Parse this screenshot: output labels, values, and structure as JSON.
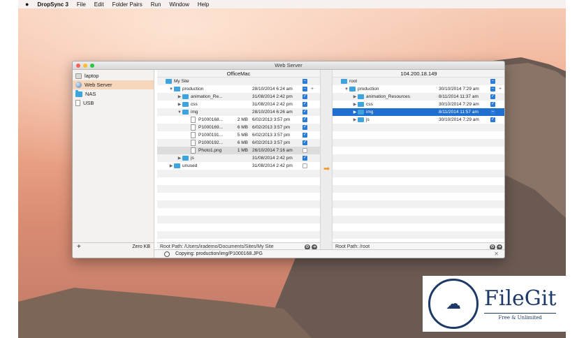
{
  "menubar": {
    "app": "DropSync 3",
    "items": [
      "File",
      "Edit",
      "Folder Pairs",
      "Run",
      "Window",
      "Help"
    ]
  },
  "window": {
    "title": "Web Server"
  },
  "sidebar": {
    "items": [
      {
        "label": "laptop",
        "icon": "display-icon"
      },
      {
        "label": "Web Server",
        "icon": "globe-icon",
        "selected": true
      },
      {
        "label": "NAS",
        "icon": "folder-icon"
      },
      {
        "label": "USB",
        "icon": "drive-icon"
      }
    ],
    "add": "+",
    "size": "Zero KB"
  },
  "left": {
    "header": "OfficeMac",
    "root_path": "Root Path: /Users/irademo/Documents/Sites/My Site",
    "rows": [
      {
        "name": "My Site",
        "indent": 0,
        "tri": "",
        "type": "folder",
        "size": "",
        "date": "",
        "check": "minus"
      },
      {
        "name": "production",
        "indent": 1,
        "tri": "▼",
        "type": "folder",
        "size": "",
        "date": "28/10/2014 6:24 am",
        "check": "minus",
        "plus": true
      },
      {
        "name": "animation_Re...",
        "indent": 2,
        "tri": "▶",
        "type": "folder",
        "size": "",
        "date": "31/08/2014 2:42 pm",
        "check": "on"
      },
      {
        "name": "css",
        "indent": 2,
        "tri": "▶",
        "type": "folder",
        "size": "",
        "date": "31/08/2014 2:42 pm",
        "check": "on"
      },
      {
        "name": "img",
        "indent": 2,
        "tri": "▼",
        "type": "folder",
        "size": "",
        "date": "28/10/2014 6:26 am",
        "check": "on"
      },
      {
        "name": "P1000168...",
        "indent": 3,
        "tri": "",
        "type": "file",
        "size": "2 MB",
        "date": "6/02/2013 3:57 pm",
        "check": "on"
      },
      {
        "name": "P1000169...",
        "indent": 3,
        "tri": "",
        "type": "file",
        "size": "6 MB",
        "date": "6/02/2013 3:57 pm",
        "check": "on"
      },
      {
        "name": "P1000191...",
        "indent": 3,
        "tri": "",
        "type": "file",
        "size": "5 MB",
        "date": "6/02/2013 3:57 pm",
        "check": "on"
      },
      {
        "name": "P1000192...",
        "indent": 3,
        "tri": "",
        "type": "file",
        "size": "6 MB",
        "date": "6/02/2013 3:57 pm",
        "check": "on"
      },
      {
        "name": "Photo1.png",
        "indent": 3,
        "tri": "",
        "type": "file",
        "size": "1 MB",
        "date": "26/10/2014 7:16 am",
        "check": "off",
        "gray": true
      },
      {
        "name": "js",
        "indent": 2,
        "tri": "▶",
        "type": "folder",
        "size": "",
        "date": "31/08/2014 2:42 pm",
        "check": "on"
      },
      {
        "name": "unused",
        "indent": 1,
        "tri": "▶",
        "type": "folder",
        "size": "",
        "date": "31/08/2014 2:42 pm",
        "check": "off"
      }
    ]
  },
  "right": {
    "header": "104.200.18.149",
    "root_path": "Root Path: /root",
    "rows": [
      {
        "name": "root",
        "indent": 0,
        "tri": "",
        "type": "folder",
        "size": "",
        "date": "",
        "check": "minus"
      },
      {
        "name": "production",
        "indent": 1,
        "tri": "▼",
        "type": "folder",
        "size": "",
        "date": "30/10/2014 7:29 am",
        "check": "minus",
        "plus": true
      },
      {
        "name": "animation_Resources",
        "indent": 2,
        "tri": "▶",
        "type": "folder",
        "size": "",
        "date": "8/11/2014 11:37 am",
        "check": "on"
      },
      {
        "name": "css",
        "indent": 2,
        "tri": "▶",
        "type": "folder",
        "size": "",
        "date": "30/10/2014 7:29 am",
        "check": "on"
      },
      {
        "name": "img",
        "indent": 2,
        "tri": "▶",
        "type": "folder",
        "size": "",
        "date": "8/11/2014 11:57 am",
        "check": "minus",
        "sel": true
      },
      {
        "name": "js",
        "indent": 2,
        "tri": "▶",
        "type": "folder",
        "size": "",
        "date": "30/10/2014 7:29 am",
        "check": "on"
      }
    ]
  },
  "status": {
    "text": "Copying: production/img/P1000168.JPG",
    "close": "✕"
  },
  "watermark": {
    "brand": "FileGit",
    "tagline": "Free & Unlimited"
  }
}
